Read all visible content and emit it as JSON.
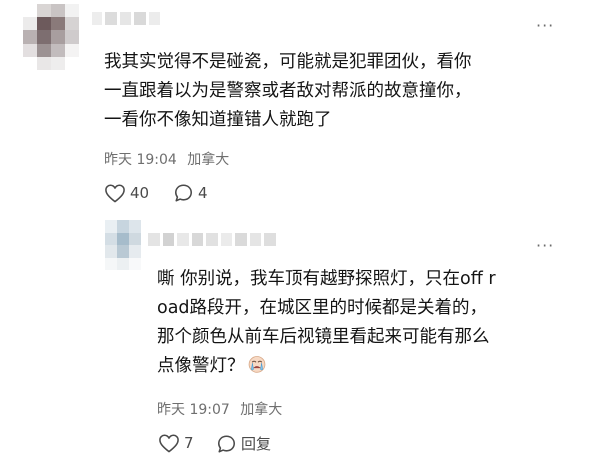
{
  "comments": [
    {
      "text_lines": [
        "我其实觉得不是碰瓷，可能就是犯罪团伙，看你",
        "一直跟着以为是警察或者敌对帮派的故意撞你，",
        "一看你不像知道撞错人就跑了"
      ],
      "timestamp": "昨天 19:04",
      "location": "加拿大",
      "likes": "40",
      "replies": "4",
      "more_label": "···"
    },
    {
      "text_lines": [
        "嘶 你别说，我车顶有越野探照灯，只在off r",
        "oad路段开，在城区里的时候都是关着的，",
        "那个颜色从前车后视镜里看起来可能有那么",
        "点像警灯？"
      ],
      "timestamp": "昨天 19:07",
      "location": "加拿大",
      "likes": "7",
      "reply_label": "回复",
      "more_label": "···"
    }
  ],
  "icons": {
    "like": "heart-outline-icon",
    "comment": "speech-bubble-icon",
    "more": "more-dots-icon",
    "emoji": "crying-face-emoji"
  }
}
